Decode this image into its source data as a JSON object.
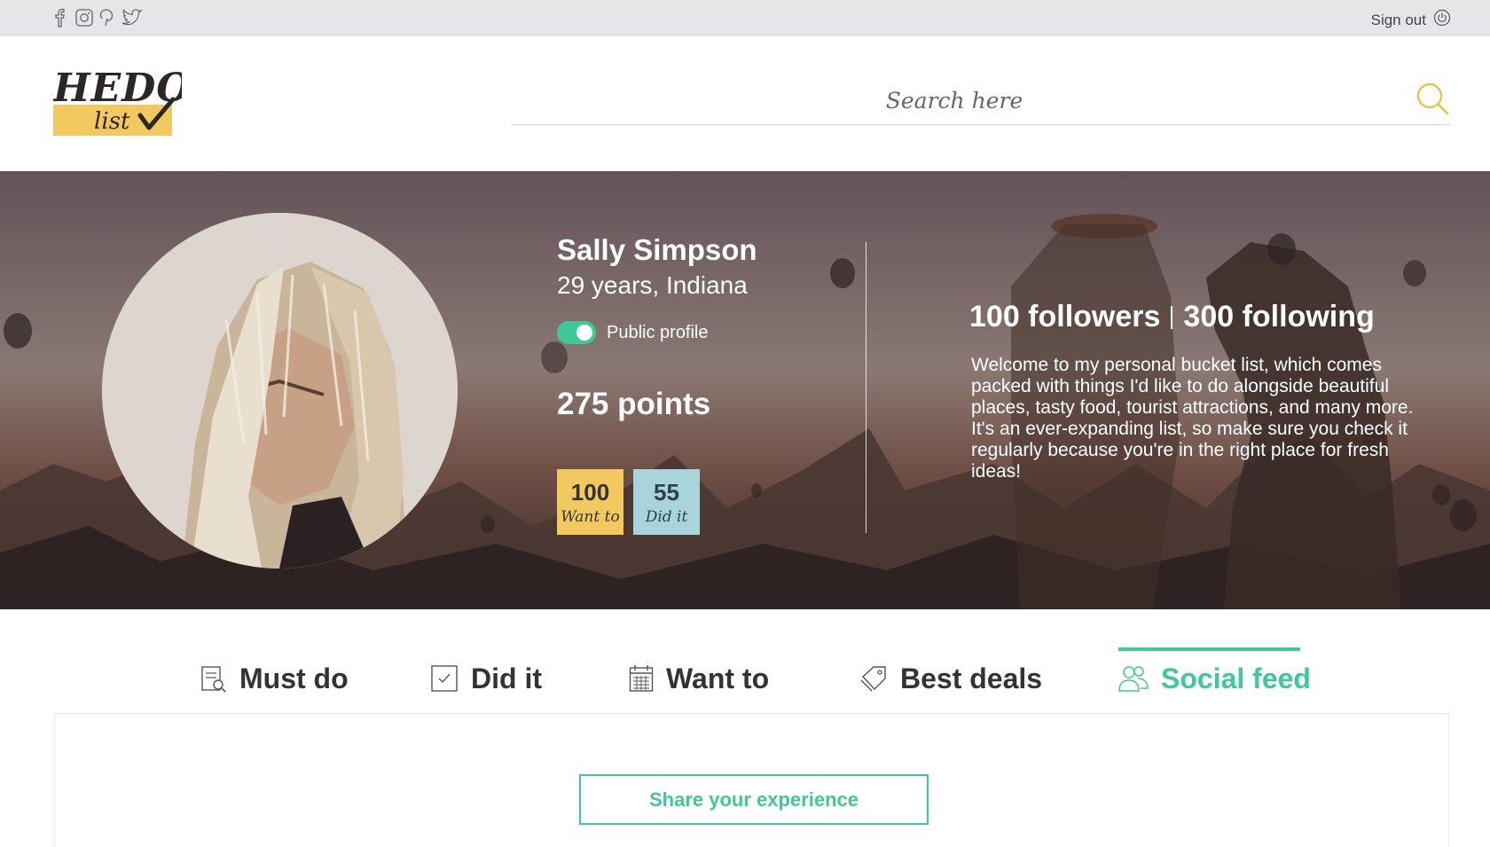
{
  "topbar": {
    "social_icons": [
      "facebook-icon",
      "instagram-icon",
      "pinterest-icon",
      "twitter-icon"
    ],
    "signout_label": "Sign out",
    "signout_icon": "power-icon"
  },
  "header": {
    "logo_text": "HEDO list",
    "search_placeholder": "Search here",
    "search_icon": "search-icon"
  },
  "profile": {
    "name": "Sally Simpson",
    "subline": "29 years, Indiana",
    "public_label": "Public profile",
    "public_enabled": true,
    "points": "275 points",
    "stats": [
      {
        "value": "100",
        "label": "Want to",
        "color": "#f2c95e"
      },
      {
        "value": "55",
        "label": "Did it",
        "color": "#a8d4dc"
      }
    ],
    "followers": "100 followers",
    "following": "300 following",
    "bio": "Welcome to my personal bucket list, which comes packed with things I'd like to do alongside beautiful places, tasty food, tourist attractions, and many more. It's an ever-expanding list, so make sure you check it regularly because you're in the right place for fresh ideas!"
  },
  "tabs": [
    {
      "label": "Must do",
      "icon": "checklist-icon",
      "active": false
    },
    {
      "label": "Did it",
      "icon": "checkbox-icon",
      "active": false
    },
    {
      "label": "Want to",
      "icon": "calendar-icon",
      "active": false
    },
    {
      "label": "Best deals",
      "icon": "tag-icon",
      "active": false
    },
    {
      "label": "Social feed",
      "icon": "users-icon",
      "active": true
    }
  ],
  "feed": {
    "share_label": "Share your experience"
  },
  "colors": {
    "accent": "#3ec998",
    "logo_yellow": "#f2c95e",
    "topbar": "#e6e6e8"
  }
}
